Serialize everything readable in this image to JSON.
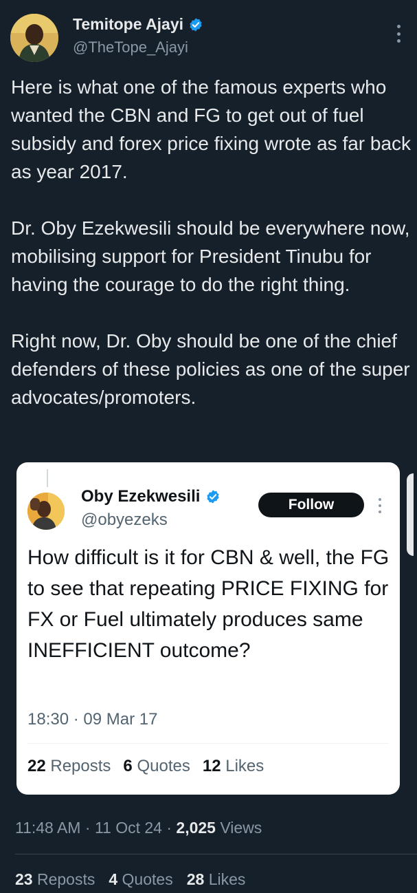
{
  "tweet": {
    "author": {
      "name": "Temitope Ajayi",
      "handle": "@TheTope_Ajayi",
      "verified": true
    },
    "paragraphs": [
      "Here is what one of the famous experts who wanted the CBN and FG to get out of fuel subsidy and forex price fixing wrote as far back as year 2017.",
      "Dr. Oby Ezekwesili should be everywhere now, mobilising support for President Tinubu for having the courage to do the right thing.",
      "Right now, Dr. Oby should be one of the chief defenders of these policies as one of the super advocates/promoters."
    ],
    "time": "11:48 AM",
    "date": "11 Oct 24",
    "views_count": "2,025",
    "views_label": "Views",
    "reposts_count": "23",
    "reposts_label": "Reposts",
    "quotes_count": "4",
    "quotes_label": "Quotes",
    "likes_count": "28",
    "likes_label": "Likes"
  },
  "embedded": {
    "author": {
      "name": "Oby Ezekwesili",
      "handle": "@obyezeks",
      "verified": true
    },
    "follow_label": "Follow",
    "text": "How difficult is it for CBN & well, the FG to see that repeating PRICE FIXING for FX or Fuel ultimately produces same INEFFICIENT outcome?",
    "time": "18:30",
    "date": "09 Mar 17",
    "reposts_count": "22",
    "reposts_label": "Reposts",
    "quotes_count": "6",
    "quotes_label": "Quotes",
    "likes_count": "12",
    "likes_label": "Likes"
  },
  "colors": {
    "background": "#15202b",
    "verified_badge": "#1d9bf0",
    "muted_text": "#8b98a5",
    "follow_button": "#0f1419"
  }
}
